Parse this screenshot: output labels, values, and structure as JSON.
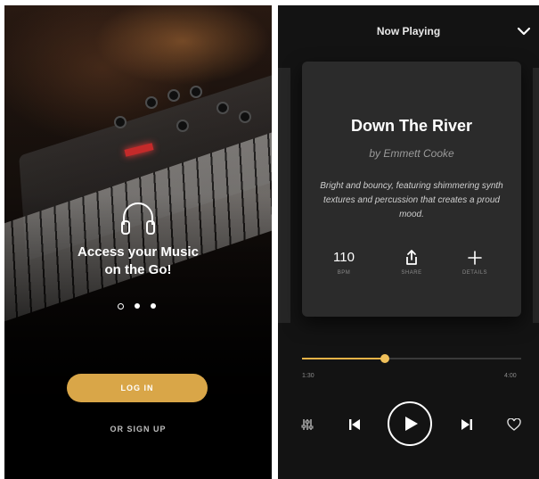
{
  "onboarding": {
    "headline_line1": "Access your Music",
    "headline_line2": "on the Go!",
    "pager": {
      "count": 3,
      "active_index": 0
    },
    "login_label": "LOG IN",
    "signup_label": "OR SIGN UP",
    "icon": "headphones-icon",
    "accent": "#d9a648"
  },
  "now_playing": {
    "header_title": "Now Playing",
    "collapse_icon": "chevron-down-icon",
    "track": {
      "title": "Down The River",
      "artist": "by Emmett Cooke",
      "description": "Bright and bouncy, featuring shimmering synth textures and percussion that creates a proud mood."
    },
    "stats": [
      {
        "value": "110",
        "label": "BPM"
      },
      {
        "icon": "share-icon",
        "label": "SHARE"
      },
      {
        "icon": "plus-icon",
        "label": "DETAILS"
      }
    ],
    "progress": {
      "fraction": 0.38,
      "elapsed": "1:30",
      "duration": "4:00"
    },
    "controls": [
      "equalizer-icon",
      "previous-icon",
      "play-icon",
      "next-icon",
      "heart-icon"
    ],
    "accent": "#e8b347"
  }
}
